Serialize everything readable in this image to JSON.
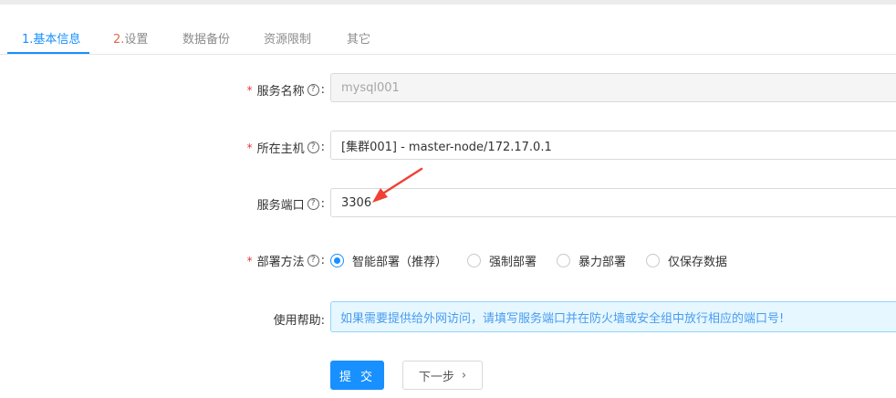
{
  "tabs": [
    {
      "num": "1.",
      "label": "基本信息",
      "active": true
    },
    {
      "num": "2.",
      "label": "设置",
      "active": false
    },
    {
      "num": "",
      "label": "数据备份",
      "active": false
    },
    {
      "num": "",
      "label": "资源限制",
      "active": false
    },
    {
      "num": "",
      "label": "其它",
      "active": false
    }
  ],
  "form": {
    "service_name": {
      "label": "服务名称",
      "value": "mysql001",
      "required_mark": "*",
      "help_icon": "?",
      "colon": ":"
    },
    "host": {
      "label": "所在主机",
      "value": "[集群001] - master-node/172.17.0.1",
      "required_mark": "*",
      "help_icon": "?",
      "colon": ":"
    },
    "port": {
      "label": "服务端口",
      "value": "3306",
      "help_icon": "?",
      "colon": ":"
    },
    "deploy": {
      "label": "部署方法",
      "required_mark": "*",
      "help_icon": "?",
      "colon": ":",
      "options": [
        {
          "label": "智能部署（推荐）",
          "checked": true
        },
        {
          "label": "强制部署",
          "checked": false
        },
        {
          "label": "暴力部署",
          "checked": false
        },
        {
          "label": "仅保存数据",
          "checked": false
        }
      ]
    },
    "help": {
      "label": "使用帮助:",
      "text": "如果需要提供给外网访问，请填写服务端口并在防火墙或安全组中放行相应的端口号!"
    }
  },
  "buttons": {
    "submit": "提 交",
    "next": "下一步",
    "next_chevron": "›"
  },
  "colors": {
    "accent": "#1890ff",
    "required": "#e8363a",
    "annotation_arrow": "#f04134"
  }
}
